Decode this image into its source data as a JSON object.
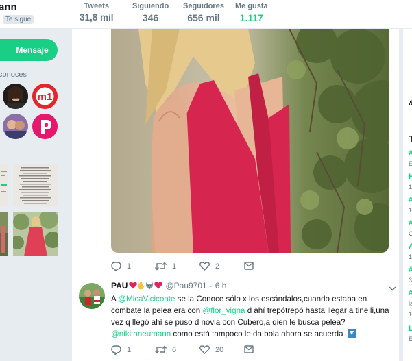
{
  "profile": {
    "name_fragment": "ann",
    "follows_you": "Te sigue"
  },
  "stats": [
    {
      "label": "Tweets",
      "value": "31,8 mil",
      "active": false
    },
    {
      "label": "Siguiendo",
      "value": "346",
      "active": false
    },
    {
      "label": "Seguidores",
      "value": "656 mil",
      "active": false
    },
    {
      "label": "Me gusta",
      "value": "1.117",
      "active": true
    }
  ],
  "sidebar": {
    "message_button": "Mensaje",
    "known_followers_label": "conoces"
  },
  "tweet": {
    "actions": {
      "replies": "1",
      "retweets": "1",
      "likes": "2"
    }
  },
  "reply": {
    "username": "PAU",
    "handle": "@Pau9701",
    "separator": "·",
    "time": "6 h",
    "text_parts": {
      "p1": "A ",
      "m1": "@MicaViciconte",
      "p2": " se la Conoce sólo x los escándalos,cuando estaba en combate la pelea era con ",
      "m2": "@flor_vigna",
      "p3": " d ahí trepótrepó hasta llegar a tinelli,una vez q llegó ahí se puso d novia con Cubero,a qien le busca pelea?",
      "m3": "@nikitaneumann",
      "p4": " como está tampoco le da bola ahora se acuerda"
    },
    "actions": {
      "replies": "1",
      "retweets": "6",
      "likes": "20"
    }
  },
  "right_column": {
    "fragments": [
      "&",
      "T",
      "#",
      "E",
      "H",
      "1",
      "#",
      "1",
      "#",
      "C",
      "A",
      "1",
      "#",
      "3",
      "#",
      "la",
      "1",
      "L",
      "E"
    ]
  },
  "colors": {
    "accent": "#19cf86",
    "heart_red": "#e0245e"
  },
  "icons": [
    "reply-icon",
    "retweet-icon",
    "like-icon",
    "chevron-down-icon",
    "down-arrow-emoji"
  ]
}
